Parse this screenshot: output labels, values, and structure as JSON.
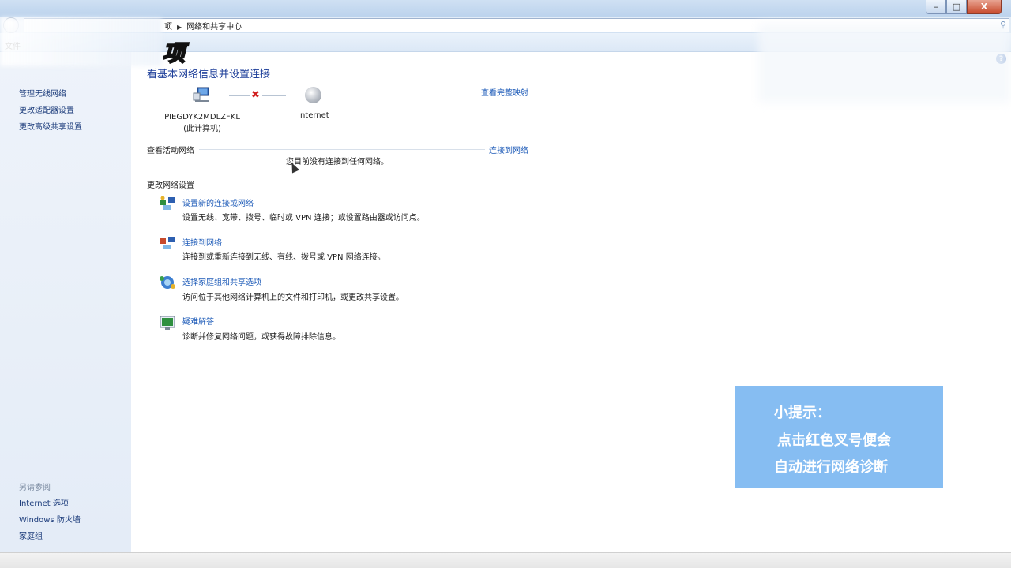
{
  "address": {
    "crumb_prefix": "项",
    "crumb_current": "网络和共享中心"
  },
  "menubar": {
    "file_label": "文件"
  },
  "overlay_char": "项",
  "sidebar": {
    "links": [
      "管理无线网络",
      "更改适配器设置",
      "更改高级共享设置"
    ],
    "see_also_title": "另请参阅",
    "see_also": [
      "Internet 选项",
      "Windows 防火墙",
      "家庭组"
    ]
  },
  "main": {
    "title": "看基本网络信息并设置连接",
    "full_map_link": "查看完整映射",
    "computer_name": "PIEGDYK2MDLZFKL",
    "computer_sub": "(此计算机)",
    "internet_label": "Internet",
    "active_networks_label": "查看活动网络",
    "connect_link": "连接到网络",
    "no_connection_text": "您目前没有连接到任何网络。",
    "change_settings_label": "更改网络设置",
    "tasks": [
      {
        "icon": "network-setup-icon",
        "link": "设置新的连接或网络",
        "desc": "设置无线、宽带、拨号、临时或 VPN 连接；或设置路由器或访问点。"
      },
      {
        "icon": "connect-network-icon",
        "link": "连接到网络",
        "desc": "连接到或重新连接到无线、有线、拨号或 VPN 网络连接。"
      },
      {
        "icon": "homegroup-icon",
        "link": "选择家庭组和共享选项",
        "desc": "访问位于其他网络计算机上的文件和打印机，或更改共享设置。"
      },
      {
        "icon": "troubleshoot-icon",
        "link": "疑难解答",
        "desc": "诊断并修复网络问题，或获得故障排除信息。"
      }
    ]
  },
  "tip": {
    "line1": "小提示：",
    "line2": "点击红色叉号便会",
    "line3": "自动进行网络诊断"
  },
  "window_buttons": {
    "minimize": "–",
    "maximize": "□",
    "close": "X"
  },
  "colors": {
    "link": "#1e5bb8",
    "title": "#1e3f9a",
    "tip_bg": "#86bdf2",
    "error_x": "#d12020"
  }
}
